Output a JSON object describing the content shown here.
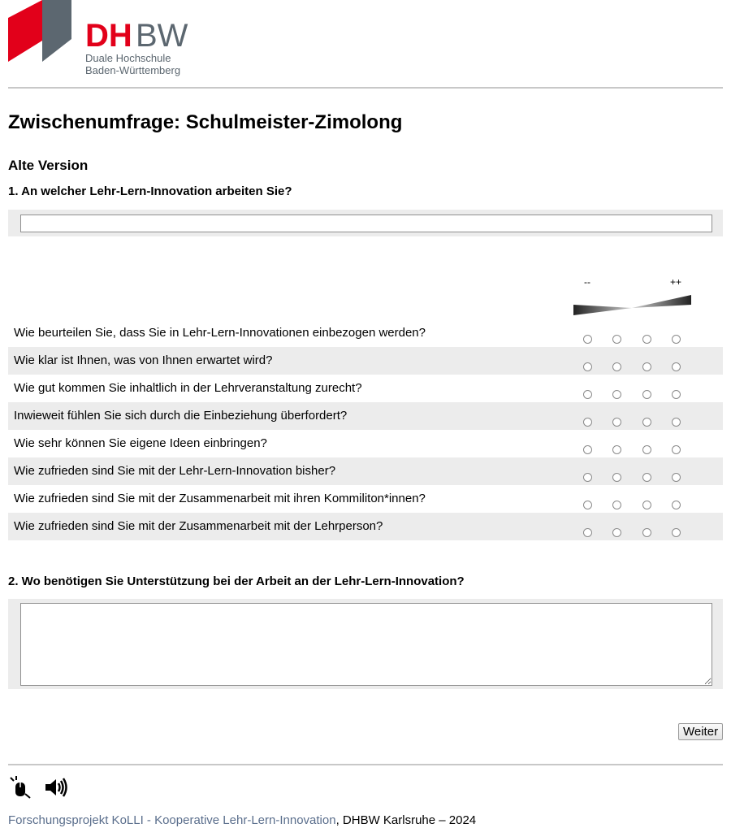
{
  "brand": {
    "name_red": "DH",
    "name_gray": "BW",
    "subtitle_line1": "Duale Hochschule",
    "subtitle_line2": "Baden-Württemberg"
  },
  "page": {
    "title": "Zwischenumfrage: Schulmeister-Zimolong",
    "section_title": "Alte Version"
  },
  "question1": {
    "label": "1. An welcher Lehr-Lern-Innovation arbeiten Sie?",
    "value": ""
  },
  "scale": {
    "low_label": "--",
    "high_label": "++",
    "options_count": 4
  },
  "matrix_rows": [
    {
      "label": "Wie beurteilen Sie, dass Sie in Lehr-Lern-Innovationen einbezogen werden?"
    },
    {
      "label": "Wie klar ist Ihnen, was von Ihnen erwartet wird?"
    },
    {
      "label": "Wie gut kommen Sie inhaltlich in der Lehrveranstaltung zurecht?"
    },
    {
      "label": "Inwieweit fühlen Sie sich durch die Einbeziehung überfordert?"
    },
    {
      "label": "Wie sehr können Sie eigene Ideen einbringen?"
    },
    {
      "label": "Wie zufrieden sind Sie mit der Lehr-Lern-Innovation bisher?"
    },
    {
      "label": "Wie zufrieden sind Sie mit der Zusammenarbeit mit ihren Kommiliton*innen?"
    },
    {
      "label": "Wie zufrieden sind Sie mit der Zusammenarbeit mit der Lehrperson?"
    }
  ],
  "question2": {
    "label": "2. Wo benötigen Sie Unterstützung bei der Arbeit an der Lehr-Lern-Innovation?",
    "value": ""
  },
  "actions": {
    "next_label": "Weiter"
  },
  "footer": {
    "icons": [
      "mouse-click-icon",
      "speaker-icon"
    ],
    "link_text": "Forschungsprojekt KoLLI - Kooperative Lehr-Lern-Innovation",
    "suffix": ", DHBW Karlsruhe – 2024"
  },
  "colors": {
    "brand_red": "#e2001a",
    "brand_gray": "#5c6770",
    "shade": "#ececec",
    "link": "#5a6e8c"
  }
}
